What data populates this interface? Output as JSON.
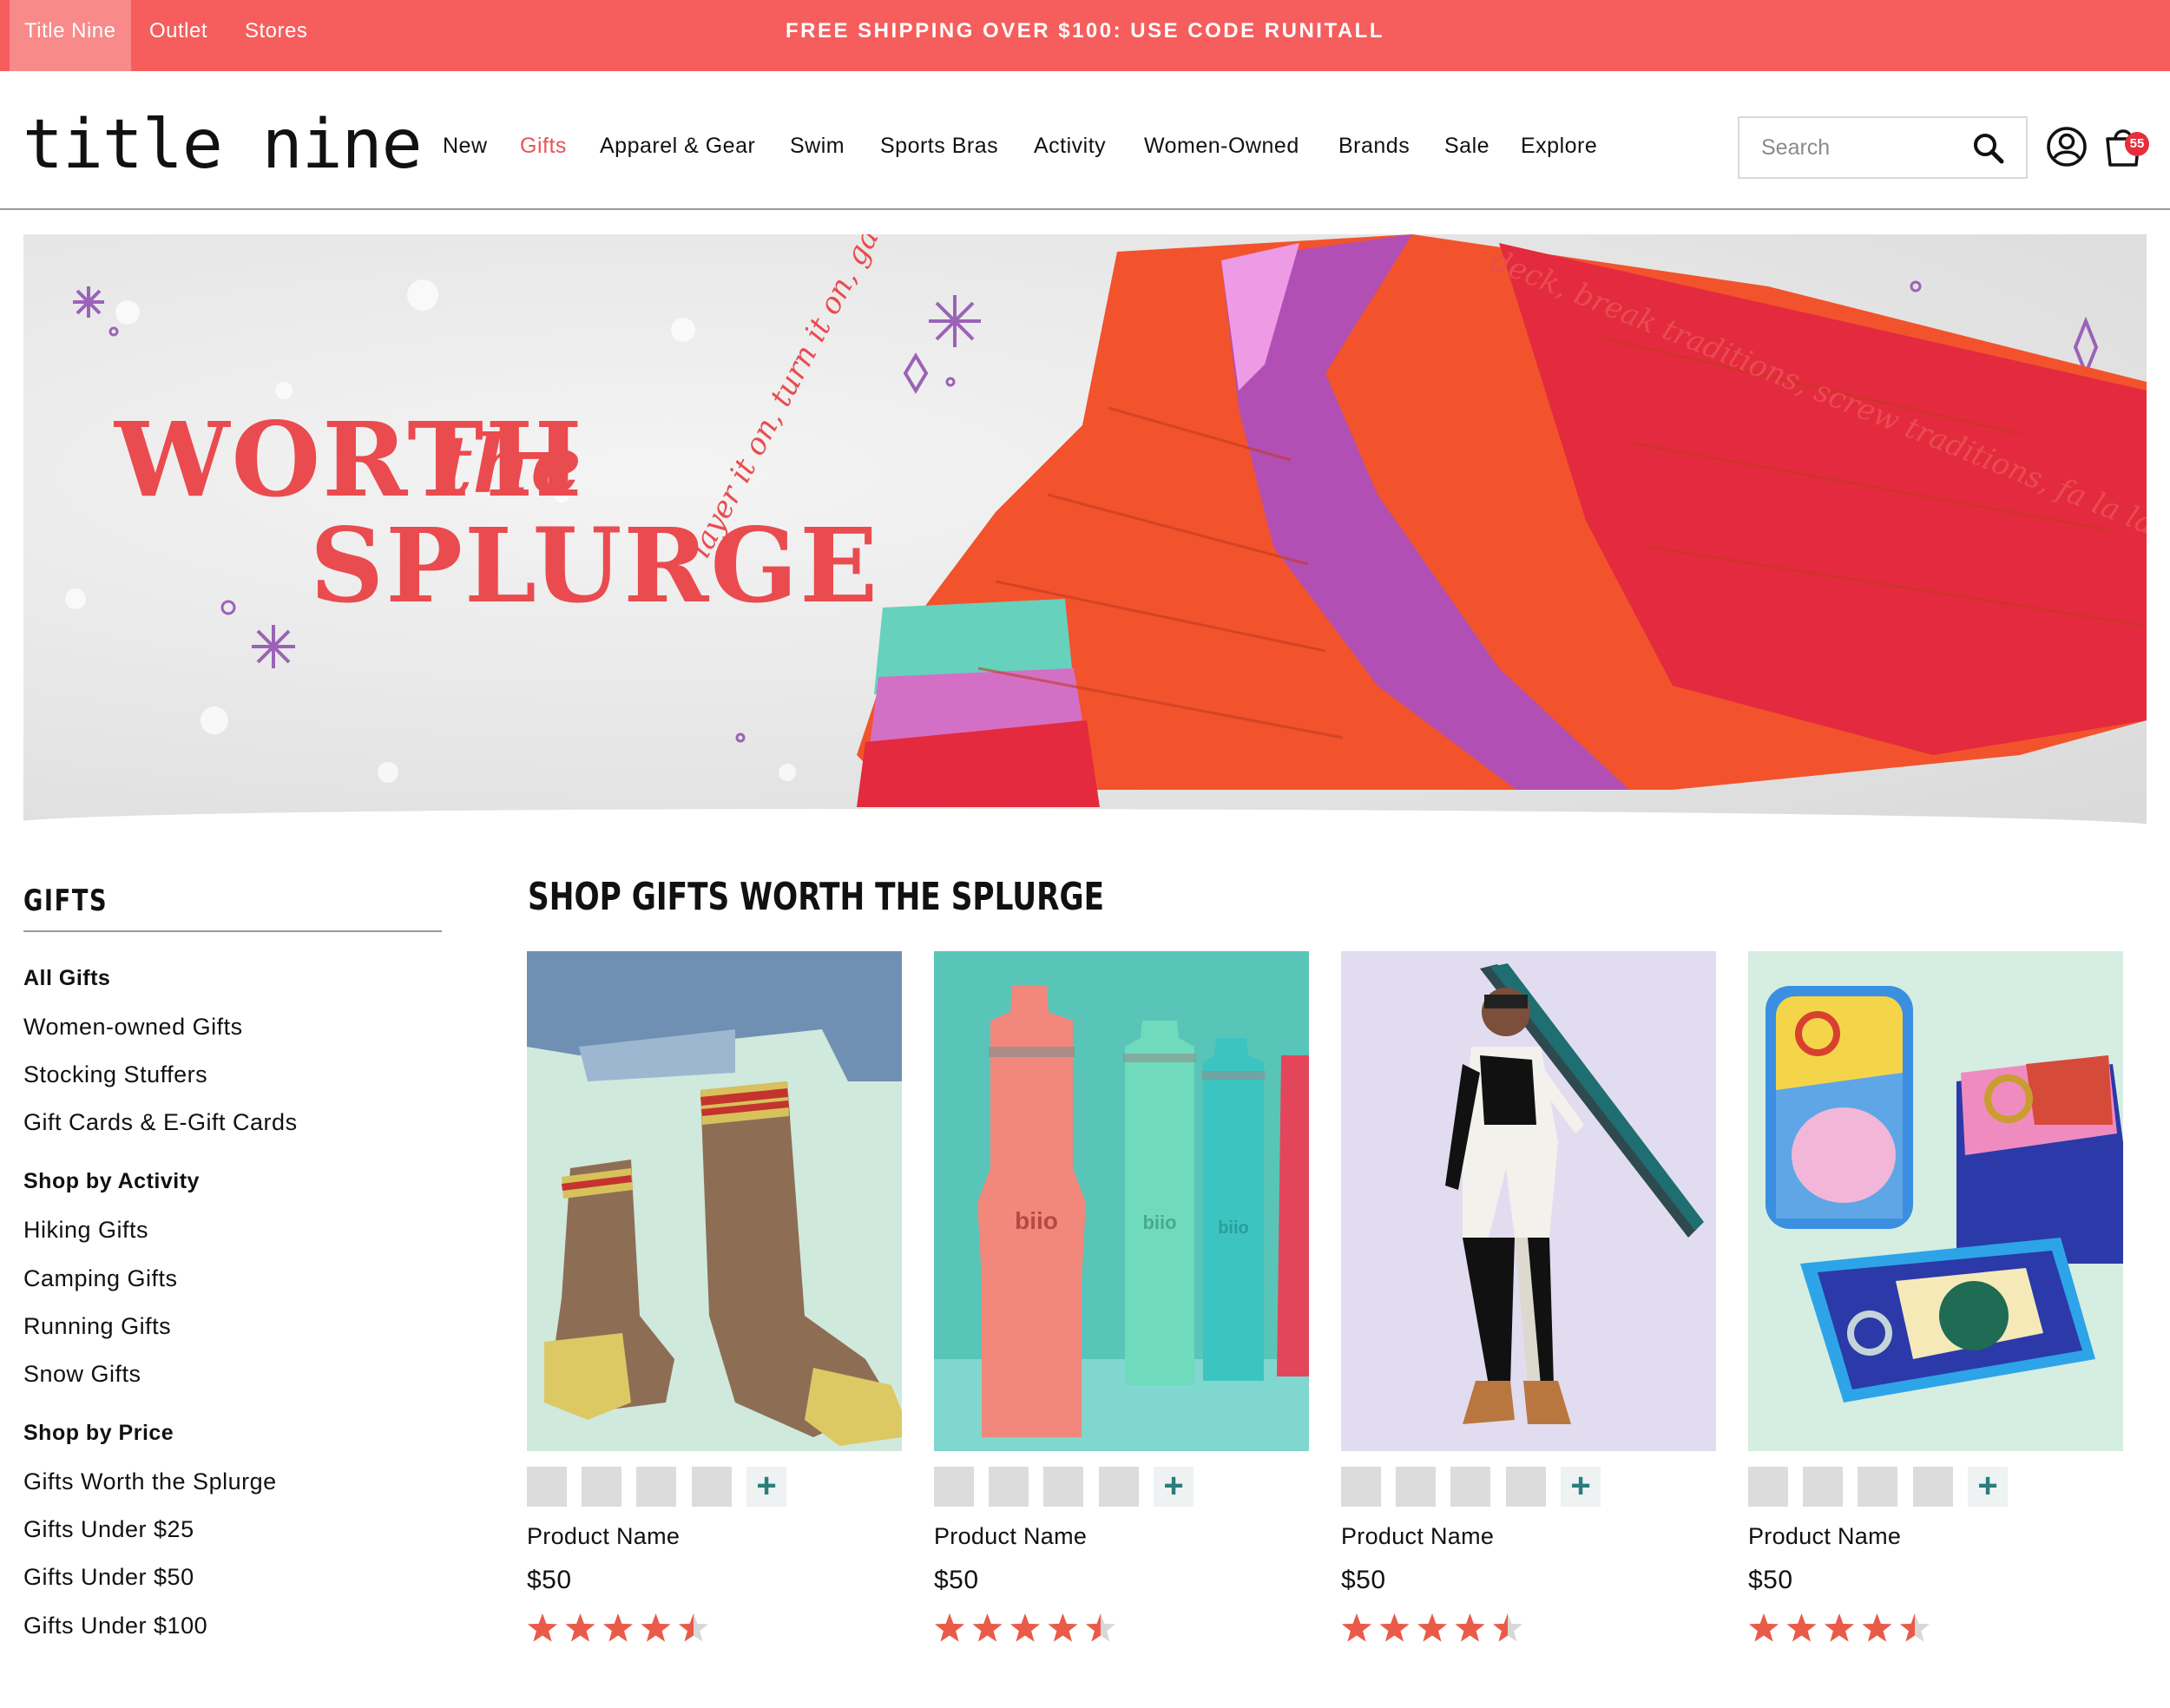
{
  "topbar": {
    "tabs": [
      "Title Nine",
      "Outlet",
      "Stores"
    ],
    "promo": "FREE SHIPPING OVER $100: USE CODE RUNITALL",
    "bg_color": "#f65d5d"
  },
  "header": {
    "logo": "title nine",
    "nav": [
      "New",
      "Gifts",
      "Apparel & Gear",
      "Swim",
      "Sports Bras",
      "Activity",
      "Women-Owned",
      "Brands",
      "Sale",
      "Explore"
    ],
    "active_nav": "Gifts",
    "search": {
      "placeholder": "Search",
      "icon": "search-icon"
    },
    "account_icon": "user-icon",
    "cart": {
      "icon": "bag-icon",
      "count": "55"
    },
    "accent_color": "#e9545a"
  },
  "hero": {
    "line1": "WORTH",
    "the": "the",
    "line2": "SPLURGE",
    "script_left": "layer it on, turn it on, game on, push your luck,",
    "script_right": "deck, break traditions, screw traditions, fa la la la",
    "color": "#ea4b4f"
  },
  "sidebar": {
    "title": "GIFTS",
    "groups": [
      {
        "heading": "All Gifts",
        "items": [
          "Women-owned Gifts",
          "Stocking Stuffers",
          "Gift Cards & E-Gift Cards"
        ]
      },
      {
        "heading": "Shop by Activity",
        "items": [
          "Hiking Gifts",
          "Camping Gifts",
          "Running Gifts",
          "Snow Gifts"
        ]
      },
      {
        "heading": "Shop by Price",
        "items": [
          "Gifts Worth the Splurge",
          "Gifts Under $25",
          "Gifts Under $50",
          "Gifts Under $100"
        ]
      }
    ]
  },
  "main": {
    "title": "SHOP GIFTS WORTH THE SPLURGE",
    "products": [
      {
        "name": "Product Name",
        "price": "$50",
        "rating": 4.5,
        "swatches": 4
      },
      {
        "name": "Product Name",
        "price": "$50",
        "rating": 4.5,
        "swatches": 4
      },
      {
        "name": "Product Name",
        "price": "$50",
        "rating": 4.5,
        "swatches": 4
      },
      {
        "name": "Product Name",
        "price": "$50",
        "rating": 4.5,
        "swatches": 4
      }
    ],
    "more_swatches_label": "+",
    "star_color": "#ea5a48"
  }
}
